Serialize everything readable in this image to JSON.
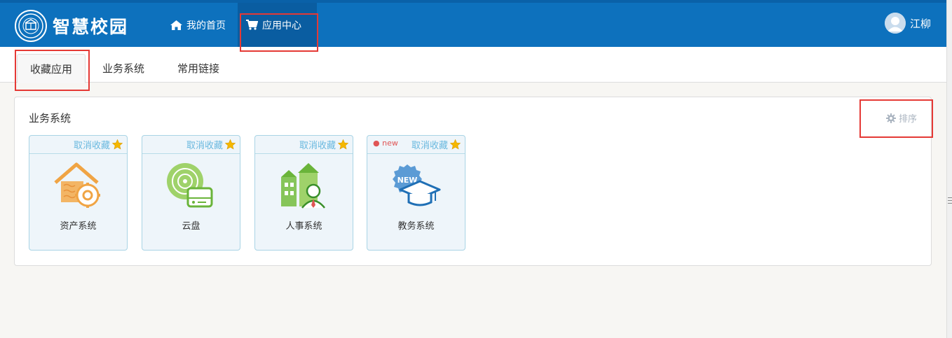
{
  "header": {
    "logo_text": "智慧校园",
    "nav": [
      {
        "label": "我的首页",
        "icon": "home-icon"
      },
      {
        "label": "应用中心",
        "icon": "cart-icon"
      }
    ],
    "user_name": "江柳"
  },
  "tabs": [
    "收藏应用",
    "业务系统",
    "常用链接"
  ],
  "panel": {
    "title": "业务系统",
    "sort_label": "排序",
    "unfavorite_label": "取消收藏",
    "new_label": "new",
    "apps": [
      {
        "name": "资产系统",
        "icon": "asset-system-icon"
      },
      {
        "name": "云盘",
        "icon": "cloud-disk-icon"
      },
      {
        "name": "人事系统",
        "icon": "hr-system-icon"
      },
      {
        "name": "教务系统",
        "icon": "academic-system-icon"
      }
    ]
  },
  "colors": {
    "header_bg": "#0d71bd",
    "active_nav_bg": "#0a5da1",
    "card_border": "#a9d4e5",
    "highlight": "#e53935",
    "star": "#f5b800"
  }
}
